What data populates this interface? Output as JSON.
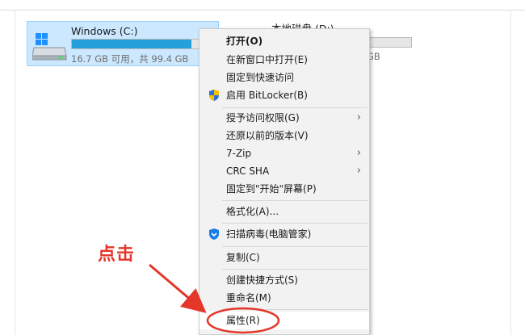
{
  "drives": [
    {
      "name": "Windows (C:)",
      "space_text": "16.7 GB 可用，共 99.4 GB",
      "usage_fraction": 0.83,
      "selected": true
    },
    {
      "name": "本地磁盘 (D:)",
      "space_text": "GB",
      "usage_fraction": 0.7,
      "selected": false
    }
  ],
  "context_menu": {
    "items": [
      {
        "label": "打开(O)",
        "bold": true
      },
      {
        "label": "在新窗口中打开(E)"
      },
      {
        "label": "固定到快速访问"
      },
      {
        "label": "启用 BitLocker(B)",
        "icon": "uac-shield-icon"
      },
      {
        "label": "授予访问权限(G)",
        "submenu": true
      },
      {
        "label": "还原以前的版本(V)"
      },
      {
        "label": "7-Zip",
        "submenu": true
      },
      {
        "label": "CRC SHA",
        "submenu": true
      },
      {
        "label": "固定到\"开始\"屏幕(P)"
      },
      {
        "label": "格式化(A)..."
      },
      {
        "label": "扫描病毒(电脑管家)",
        "icon": "tencent-guard-icon"
      },
      {
        "label": "复制(C)"
      },
      {
        "label": "创建快捷方式(S)"
      },
      {
        "label": "重命名(M)"
      },
      {
        "label": "属性(R)",
        "highlighted": true
      }
    ],
    "submenu_glyph": "›"
  },
  "annotation": {
    "label": "点击",
    "color": "#e5362a"
  },
  "colors": {
    "selection_bg": "#cce8ff",
    "selection_border": "#99d1ff",
    "usage_bar": "#26a0da",
    "menu_bg": "#f2f2f2"
  }
}
